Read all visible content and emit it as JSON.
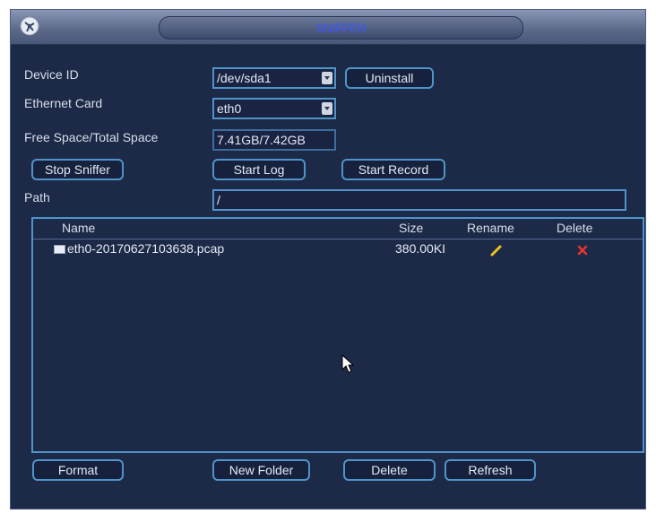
{
  "title": "SNIFFER",
  "form": {
    "device_id_label": "Device ID",
    "device_id_value": "/dev/sda1",
    "uninstall_label": "Uninstall",
    "ethernet_label": "Ethernet Card",
    "ethernet_value": "eth0",
    "space_label": "Free Space/Total Space",
    "space_value": "7.41GB/7.42GB",
    "stop_sniffer_label": "Stop Sniffer",
    "start_log_label": "Start Log",
    "start_record_label": "Start Record",
    "path_label": "Path",
    "path_value": "/"
  },
  "list": {
    "columns": {
      "name": "Name",
      "size": "Size",
      "rename": "Rename",
      "delete": "Delete"
    },
    "rows": [
      {
        "name": "eth0-20170627103638.pcap",
        "size": "380.00KI",
        "rename_icon": "pencil-icon",
        "delete_icon": "x-icon"
      }
    ]
  },
  "footer": {
    "format_label": "Format",
    "new_folder_label": "New Folder",
    "delete_label": "Delete",
    "refresh_label": "Refresh"
  },
  "colors": {
    "background": "#1c2947",
    "accent_border": "#4f94c9",
    "title_text": "#3a58ff",
    "rename_icon": "#f2c21a",
    "delete_icon": "#e8352a"
  }
}
